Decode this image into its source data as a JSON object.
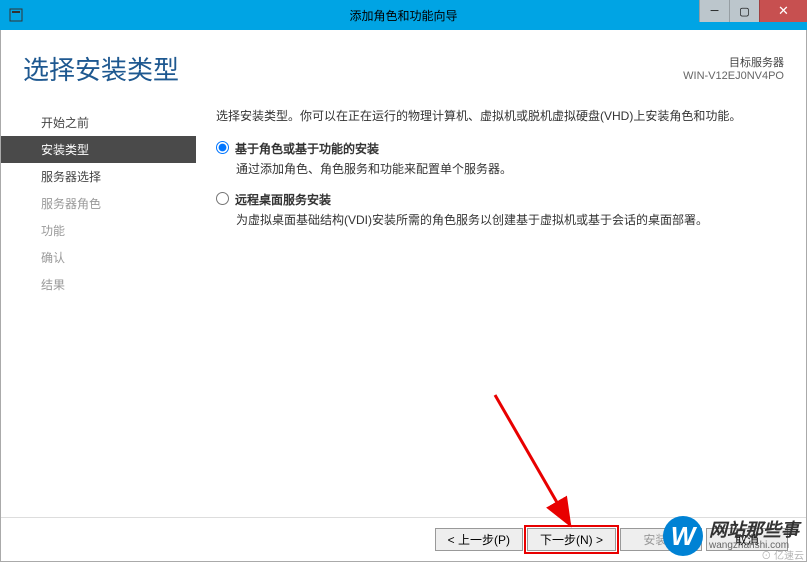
{
  "titlebar": {
    "title": "添加角色和功能向导"
  },
  "header": {
    "page_title": "选择安装类型",
    "target_label": "目标服务器",
    "target_value": "WIN-V12EJ0NV4PO"
  },
  "sidebar": {
    "items": [
      {
        "label": "开始之前",
        "enabled": true,
        "active": false
      },
      {
        "label": "安装类型",
        "enabled": true,
        "active": true
      },
      {
        "label": "服务器选择",
        "enabled": true,
        "active": false
      },
      {
        "label": "服务器角色",
        "enabled": false,
        "active": false
      },
      {
        "label": "功能",
        "enabled": false,
        "active": false
      },
      {
        "label": "确认",
        "enabled": false,
        "active": false
      },
      {
        "label": "结果",
        "enabled": false,
        "active": false
      }
    ]
  },
  "content": {
    "instruction": "选择安装类型。你可以在正在运行的物理计算机、虚拟机或脱机虚拟硬盘(VHD)上安装角色和功能。",
    "options": [
      {
        "label": "基于角色或基于功能的安装",
        "desc": "通过添加角色、角色服务和功能来配置单个服务器。",
        "checked": true
      },
      {
        "label": "远程桌面服务安装",
        "desc": "为虚拟桌面基础结构(VDI)安装所需的角色服务以创建基于虚拟机或基于会话的桌面部署。",
        "checked": false
      }
    ]
  },
  "footer": {
    "prev": "< 上一步(P)",
    "next": "下一步(N) >",
    "install": "安装(I)",
    "cancel": "取消"
  },
  "watermark": {
    "badge": "W",
    "label": "网站那些事",
    "url": "wangzhanshi.com",
    "corner": "⊙ 亿速云"
  }
}
